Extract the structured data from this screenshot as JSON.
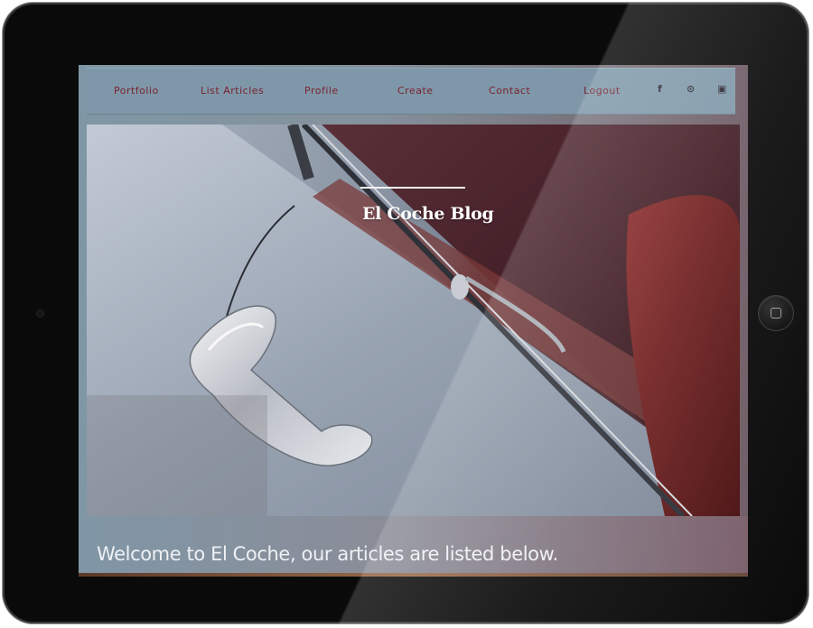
{
  "nav": {
    "items": [
      {
        "label": "Portfolio"
      },
      {
        "label": "List Articles"
      },
      {
        "label": "Profile"
      },
      {
        "label": "Create"
      },
      {
        "label": "Contact"
      },
      {
        "label": "Logout"
      }
    ],
    "social": [
      {
        "icon": "facebook-icon",
        "glyph": "f"
      },
      {
        "icon": "github-icon",
        "glyph": "⊙"
      },
      {
        "icon": "instagram-icon",
        "glyph": "▣"
      }
    ]
  },
  "hero": {
    "title": "El Coche Blog"
  },
  "welcome": {
    "text": "Welcome to El Coche, our articles are listed below."
  },
  "colors": {
    "nav_bg": "#7f98a9",
    "nav_text": "#7a2230",
    "bezel": "#0a0a0a"
  }
}
